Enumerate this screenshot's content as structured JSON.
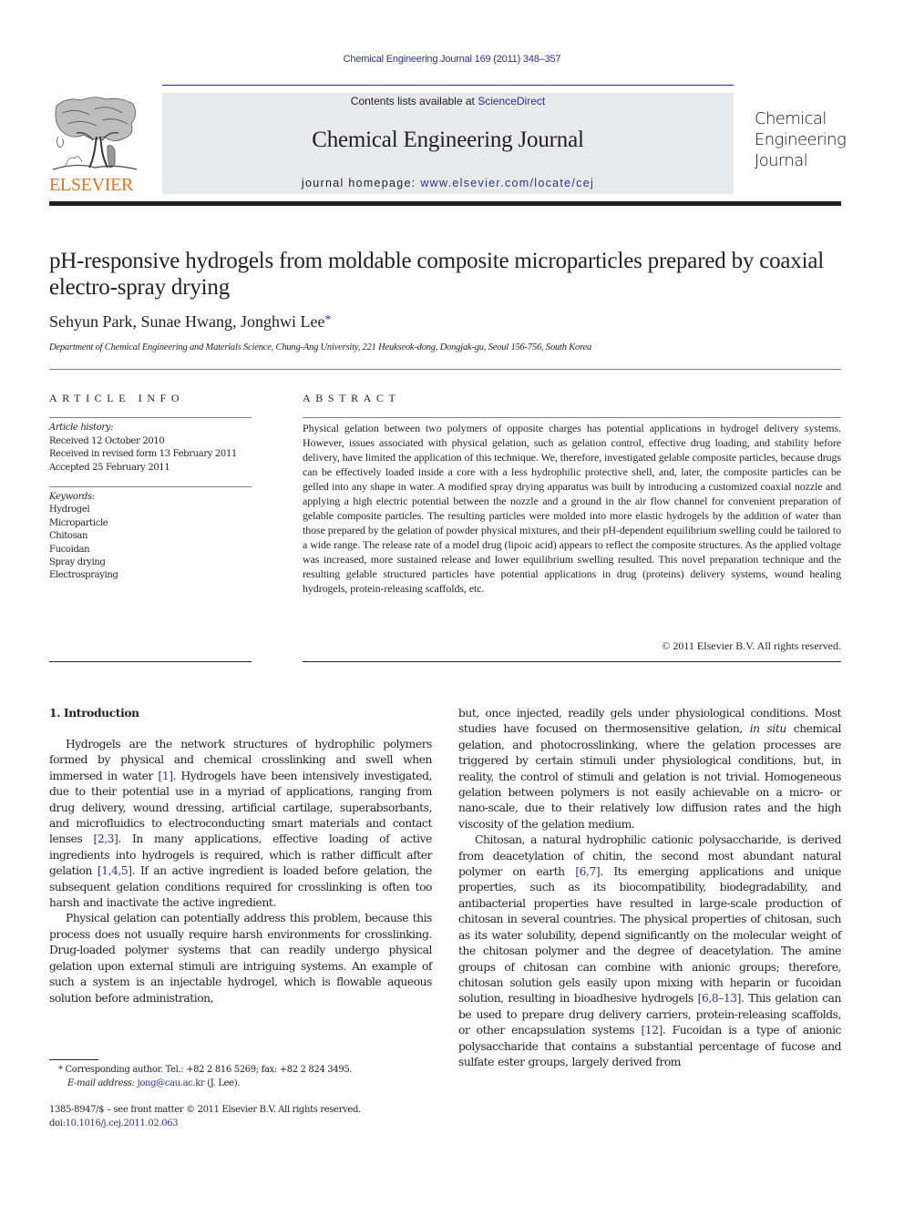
{
  "header": {
    "citation": "Chemical Engineering Journal 169 (2011) 348–357",
    "publisher_logo": {
      "icon": "elsevier-tree-icon",
      "wordmark": "ELSEVIER",
      "color": "#e9711c"
    },
    "banner": {
      "contents_prefix": "Contents lists available at ",
      "contents_link": "ScienceDirect",
      "journal_title": "Chemical Engineering Journal",
      "homepage_prefix": "journal homepage: ",
      "homepage_link": "www.elsevier.com/locate/cej",
      "background": "#e8e9ea"
    },
    "journal_logo_lines": [
      "Chemical",
      "Engineering",
      "Journal"
    ],
    "link_color": "#2e3192"
  },
  "article": {
    "title": "pH-responsive hydrogels from moldable composite microparticles prepared by coaxial electro-spray drying",
    "authors": "Sehyun Park, Sunae Hwang, Jonghwi Lee",
    "corresponding_mark": "*",
    "affiliation": "Department of Chemical Engineering and Materials Science, Chung-Ang University, 221 Heukseok-dong, Dongjak-gu, Seoul 156-756, South Korea"
  },
  "article_info": {
    "heading": "ARTICLE INFO",
    "history_label": "Article history:",
    "history": [
      "Received 12 October 2010",
      "Received in revised form 13 February 2011",
      "Accepted 25 February 2011"
    ],
    "keywords_label": "Keywords:",
    "keywords": [
      "Hydrogel",
      "Microparticle",
      "Chitosan",
      "Fucoidan",
      "Spray drying",
      "Electrospraying"
    ]
  },
  "abstract": {
    "heading": "ABSTRACT",
    "text": "Physical gelation between two polymers of opposite charges has potential applications in hydrogel delivery systems. However, issues associated with physical gelation, such as gelation control, effec­tive drug loading, and stability before delivery, have limited the application of this technique. We, therefore, investigated gelable composite particles, because drugs can be effectively loaded inside a core with a less hydrophilic protective shell, and, later, the composite particles can be gelled into any shape in water. A modified spray drying apparatus was built by introducing a customized coaxial nozzle and applying a high electric potential between the nozzle and a ground in the air flow chan­nel for convenient preparation of gelable composite particles. The resulting particles were molded into more elastic hydrogels by the addition of water than those prepared by the gelation of pow­der physical mixtures, and their pH-dependent equilibrium swelling could be tailored to a wide range. The release rate of a model drug (lipoic acid) appears to reflect the composite structures. As the applied voltage was increased, more sustained release and lower equilibrium swelling resulted. This novel preparation technique and the resulting gelable structured particles have potential appli­cations in drug (proteins) delivery systems, wound healing hydrogels, protein-releasing scaffolds, etc.",
    "copyright": "© 2011 Elsevier B.V. All rights reserved."
  },
  "body": {
    "section_heading": "1.  Introduction",
    "left_paragraphs": [
      [
        {
          "t": "Hydrogels are the network structures of hydrophilic poly­mers formed by physical and chemical crosslinking and swell when immersed in water "
        },
        {
          "t": "[1]",
          "link": true
        },
        {
          "t": ". Hydrogels have been intensively investigated, due to their potential use in a myriad of appli­cations, ranging from drug delivery, wound dressing, artificial cartilage, superabsorbants, and microfluidics to electroconduct­ing smart materials and contact lenses "
        },
        {
          "t": "[2,3]",
          "link": true
        },
        {
          "t": ". In many applications, effective loading of active ingredients into hydrogels is required, which is rather difficult after gelation "
        },
        {
          "t": "[1,4,5]",
          "link": true
        },
        {
          "t": ". If an active ingre­dient is loaded before gelation, the subsequent gelation conditions required for crosslinking is often too harsh and inactivate the active ingredient."
        }
      ],
      [
        {
          "t": "Physical gelation can potentially address this problem, because this process does not usually require harsh environments for crosslinking. Drug-loaded polymer systems that can readily undergo physical gelation upon external stimuli are intriguing systems. An example of such a system is an injectable hydro­gel, which is flowable aqueous solution before administration,"
        }
      ]
    ],
    "right_paragraphs": [
      [
        {
          "t": "but, once injected, readily gels under physiological conditions. Most studies have focused on thermosensitive gelation, "
        },
        {
          "t": "in situ",
          "italic": true
        },
        {
          "t": " chemical gelation, and photocrosslinking, where the gelation processes are triggered by certain stimuli under physiological conditions, but, in reality, the control of stimuli and gelation is not trivial. Homogeneous gelation between polymers is not easily achievable on a micro- or nano-scale, due to their rela­tively low diffusion rates and the high viscosity of the gelation medium."
        }
      ],
      [
        {
          "t": "Chitosan, a natural hydrophilic cationic polysaccharide, is derived from deacetylation of chitin, the second most abundant natural polymer on earth "
        },
        {
          "t": "[6,7]",
          "link": true
        },
        {
          "t": ". Its emerging applications and unique properties, such as its biocompatibility, biodegradability, and antibacterial properties have resulted in large-scale production of chitosan in several countries. The physical properties of chitosan, such as its water solubility, depend significantly on the molecular weight of the chitosan polymer and the degree of deacetylation. The amine groups of chitosan can combine with anionic groups; therefore, chitosan solution gels easily upon mixing with heparin or fucoidan solution, resulting in bioadhesive hydrogels "
        },
        {
          "t": "[6,8–13]",
          "link": true
        },
        {
          "t": ". This gelation can be used to prepare drug delivery carriers, protein-releasing scaffolds, or other encapsulation systems "
        },
        {
          "t": "[12]",
          "link": true
        },
        {
          "t": ". Fucoidan is a type of anionic polysaccharide that contains a substantial per­centage of fucose and sulfate ester groups, largely derived from"
        }
      ]
    ]
  },
  "footnotes": {
    "corresponding_mark": "*",
    "corresponding": "Corresponding author. Tel.: +82 2 816 5269; fax: +82 2 824 3495.",
    "email_label": "E-mail address:",
    "email": "jong@cau.ac.kr",
    "email_suffix": " (J. Lee).",
    "front_matter": "1385-8947/$ – see front matter © 2011 Elsevier B.V. All rights reserved.",
    "doi_prefix": "doi:",
    "doi": "10.1016/j.cej.2011.02.063"
  }
}
